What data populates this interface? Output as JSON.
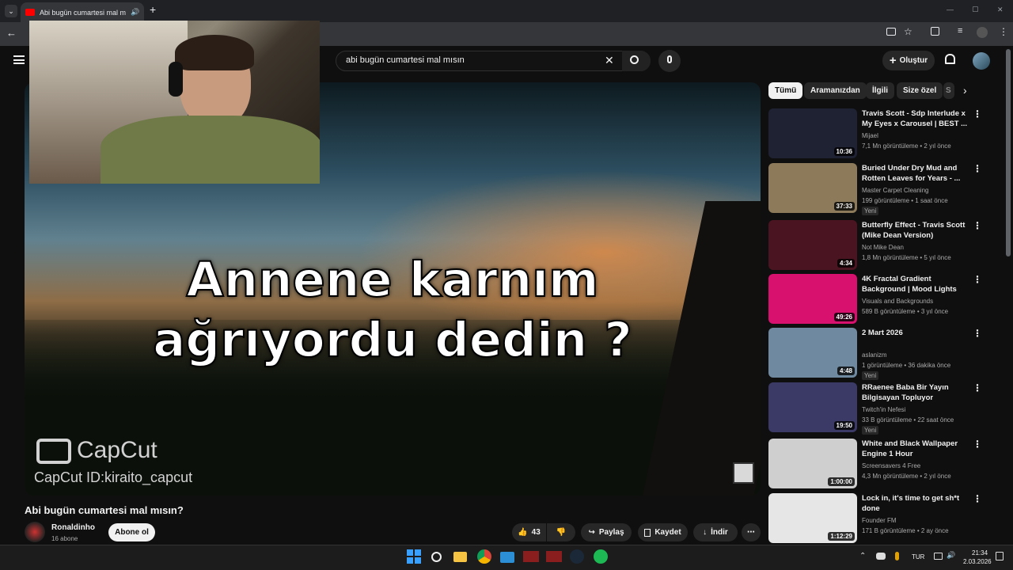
{
  "browser": {
    "tab_title": "Abi bugün cumartesi mal m",
    "new_tab": "+",
    "win_min": "—",
    "win_max": "▢",
    "win_close": "✕"
  },
  "youtube": {
    "search_value": "abi bugün cumartesi mal mısın",
    "create_label": "Oluştur"
  },
  "video": {
    "caption_line1": "Annene karnım",
    "caption_line2": "ağrıyordu dedin ?",
    "watermark": "CapCut",
    "watermark_id": "CapCut ID:kiraito_capcut",
    "title": "Abi bugün cumartesi mal mısın?",
    "channel": "Ronaldinho",
    "subscribers": "16 abone",
    "subscribe_label": "Abone ol",
    "likes": "43",
    "share_label": "Paylaş",
    "save_label": "Kaydet",
    "download_label": "İndir"
  },
  "chips": [
    "Tümü",
    "Aramanızdan",
    "İlgili",
    "Size özel",
    "S"
  ],
  "recommendations": [
    {
      "title": "Travis Scott - Sdp Interlude x My Eyes x Carousel | BEST ...",
      "channel": "Mijael",
      "meta": "7,1 Mn görüntüleme • 2 yıl önce",
      "duration": "10:36",
      "badge": "",
      "color": "#1e2233"
    },
    {
      "title": "Buried Under Dry Mud and Rotten Leaves for Years - ...",
      "channel": "Master Carpet Cleaning",
      "meta": "199 görüntüleme • 1 saat önce",
      "duration": "37:33",
      "badge": "Yeni",
      "color": "#8c7a5a"
    },
    {
      "title": "Butterfly Effect - Travis Scott (Mike Dean Version)",
      "channel": "Not Mike Dean",
      "meta": "1,8 Mn görüntüleme • 5 yıl önce",
      "duration": "4:34",
      "badge": "",
      "color": "#4a1420"
    },
    {
      "title": "4K Fractal Gradient Background | Mood Lights",
      "channel": "Visuals and Backgrounds",
      "meta": "589 B görüntüleme • 3 yıl önce",
      "duration": "49:26",
      "badge": "",
      "color": "#d8106e"
    },
    {
      "title": "2 Mart 2026",
      "channel": "aslanizm",
      "meta": "1 görüntüleme • 36 dakika önce",
      "duration": "4:48",
      "badge": "Yeni",
      "color": "#6f8aa0"
    },
    {
      "title": "RRaenee Baba Bir Yayın Bilgisayan Topluyor",
      "channel": "Twitch'in Nefesi",
      "meta": "33 B görüntüleme • 22 saat önce",
      "duration": "19:50",
      "badge": "Yeni",
      "color": "#3b3a66"
    },
    {
      "title": "White and Black Wallpaper Engine 1 Hour",
      "channel": "Screensavers 4 Free",
      "meta": "4,3 Mn görüntüleme • 2 yıl önce",
      "duration": "1:00:00",
      "badge": "",
      "color": "#cfcfcf"
    },
    {
      "title": "Lock in, it's time to get sh*t done",
      "channel": "Founder FM",
      "meta": "171 B görüntüleme • 2 ay önce",
      "duration": "1:12:29",
      "badge": "",
      "color": "#e6e6e6"
    }
  ],
  "taskbar": {
    "lang": "TUR",
    "time": "21:34",
    "date": "2.03.2026"
  },
  "colors": {
    "accent": "#ff0000",
    "page_bg": "#0f0f0f",
    "chip_active_bg": "#f1f1f1"
  }
}
